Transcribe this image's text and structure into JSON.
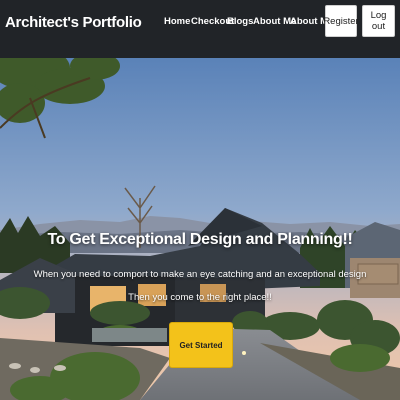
{
  "brand": {
    "title": "Architect's Portfolio"
  },
  "nav": {
    "links": [
      "Home",
      "Checkout",
      "Blogs",
      "About Me",
      "About Me"
    ],
    "register_label": "Register",
    "logout_label": "Log out"
  },
  "hero": {
    "title": "To Get Exceptional Design and Planning!!",
    "subtitle_line1": "When you need to comport to make an eye catching and an exceptional design",
    "subtitle_line2": "Then you come to the right place!!",
    "cta_label": "Get Started"
  },
  "colors": {
    "navbar": "#212428",
    "cta": "#f3c21a",
    "sky_top": "#5a82b8",
    "sky_bottom": "#f0c9a8"
  }
}
